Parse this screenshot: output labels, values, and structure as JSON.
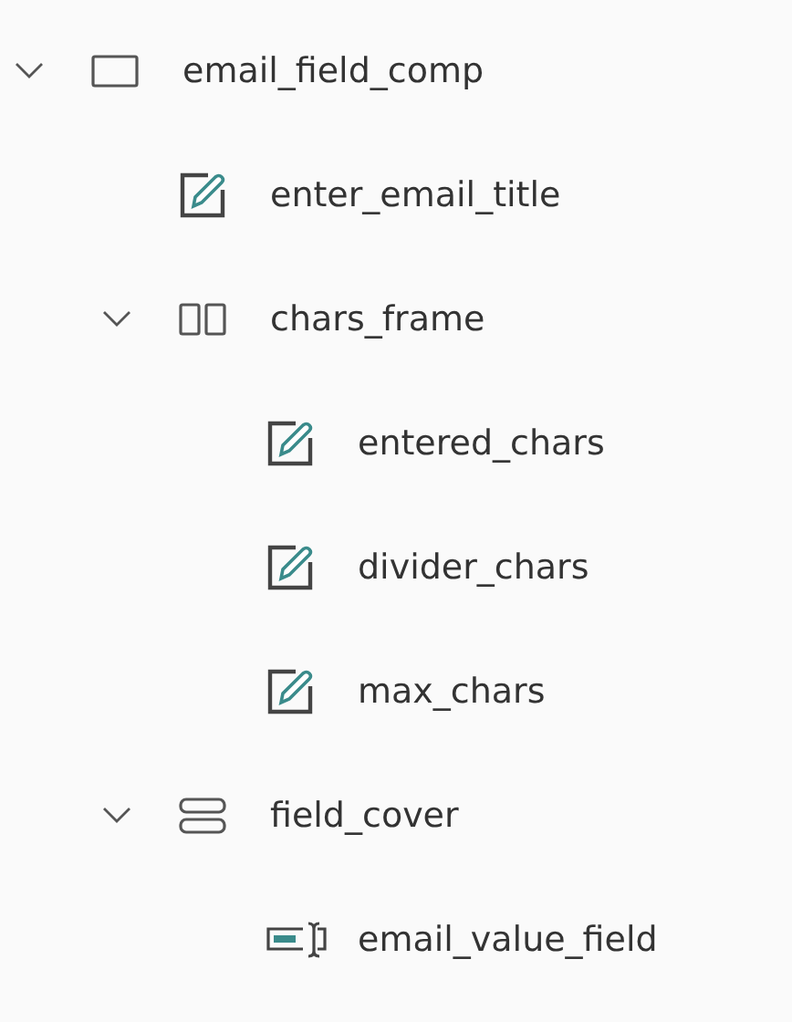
{
  "tree": [
    {
      "name": "email_field_comp",
      "kind": "screen",
      "expanded": true,
      "children": [
        {
          "name": "enter_email_title",
          "kind": "label"
        },
        {
          "name": "chars_frame",
          "kind": "horizontal",
          "expanded": true,
          "children": [
            {
              "name": "entered_chars",
              "kind": "label"
            },
            {
              "name": "divider_chars",
              "kind": "label"
            },
            {
              "name": "max_chars",
              "kind": "label"
            }
          ]
        },
        {
          "name": "field_cover",
          "kind": "vertical",
          "expanded": true,
          "children": [
            {
              "name": "email_value_field",
              "kind": "textinput"
            }
          ]
        }
      ]
    }
  ]
}
